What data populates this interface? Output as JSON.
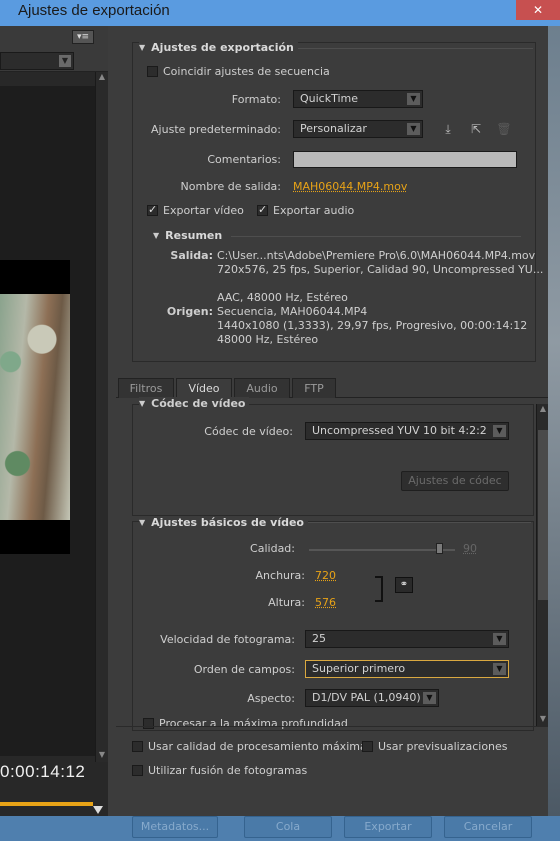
{
  "window": {
    "title": "Ajustes de exportación",
    "close_glyph": "✕"
  },
  "left_panel": {
    "timecode": "0:00:14:12"
  },
  "export_settings": {
    "header": "Ajustes de exportación",
    "match_sequence_label": "Coincidir ajustes de secuencia",
    "match_sequence_checked": false,
    "format_label": "Formato:",
    "format_value": "QuickTime",
    "preset_label": "Ajuste predeterminado:",
    "preset_value": "Personalizar",
    "comments_label": "Comentarios:",
    "comments_value": "",
    "output_name_label": "Nombre de salida:",
    "output_name_value": "MAH06044.MP4.mov",
    "export_video_label": "Exportar vídeo",
    "export_video_checked": true,
    "export_audio_label": "Exportar audio",
    "export_audio_checked": true,
    "icons": [
      "save-preset-icon",
      "import-preset-icon",
      "delete-preset-icon"
    ]
  },
  "summary": {
    "header": "Resumen",
    "output_label": "Salida:",
    "output_lines": [
      "C:\\User...nts\\Adobe\\Premiere Pro\\6.0\\MAH06044.MP4.mov",
      "720x576, 25 fps, Superior, Calidad 90, Uncompressed YU..."
    ],
    "output_audio": "AAC, 48000 Hz, Estéreo",
    "source_label": "Origen:",
    "source_lines": [
      "Secuencia, MAH06044.MP4",
      "1440x1080 (1,3333), 29,97 fps, Progresivo, 00:00:14:12",
      "48000 Hz, Estéreo"
    ]
  },
  "tabs": [
    {
      "label": "Filtros",
      "active": false
    },
    {
      "label": "Vídeo",
      "active": true
    },
    {
      "label": "Audio",
      "active": false
    },
    {
      "label": "FTP",
      "active": false
    }
  ],
  "codec": {
    "header": "Códec de vídeo",
    "codec_label": "Códec de vídeo:",
    "codec_value": "Uncompressed YUV 10 bit 4:2:2",
    "codec_settings_button": "Ajustes de códec"
  },
  "basic": {
    "header": "Ajustes básicos de vídeo",
    "quality_label": "Calidad:",
    "quality_value": "90",
    "width_label": "Anchura:",
    "width_value": "720",
    "height_label": "Altura:",
    "height_value": "576",
    "frame_rate_label": "Velocidad de fotograma:",
    "frame_rate_value": "25",
    "field_order_label": "Orden de campos:",
    "field_order_value": "Superior primero",
    "aspect_label": "Aspecto:",
    "aspect_value": "D1/DV PAL (1,0940)",
    "max_depth_label": "Procesar a la máxima profundidad"
  },
  "options": {
    "max_quality_label": "Usar calidad de procesamiento máxima",
    "previews_label": "Usar previsualizaciones",
    "frame_blend_label": "Utilizar fusión de fotogramas"
  },
  "buttons": {
    "metadata": "Metadatos...",
    "queue": "Cola",
    "export": "Exportar",
    "cancel": "Cancelar"
  }
}
